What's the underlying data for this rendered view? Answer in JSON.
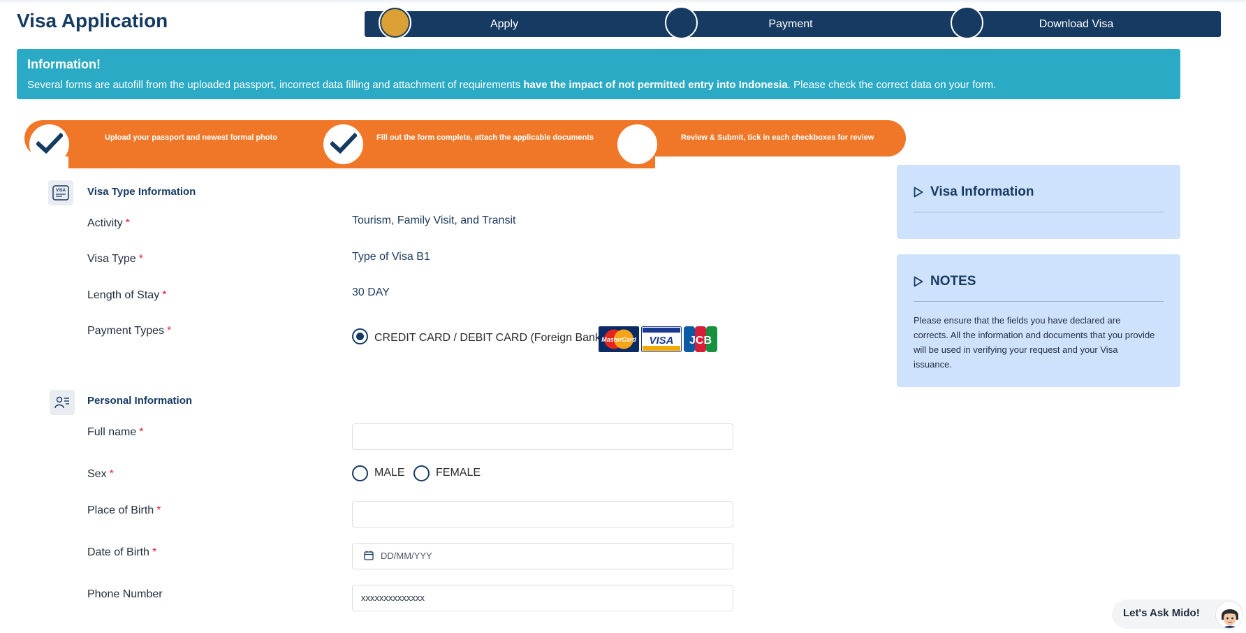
{
  "header": {
    "title": "Visa Application"
  },
  "steps": [
    {
      "label": "Apply",
      "active": true
    },
    {
      "label": "Payment",
      "active": false
    },
    {
      "label": "Download Visa",
      "active": false
    }
  ],
  "info": {
    "title": "Information!",
    "text_before": "Several forms are autofill from the uploaded passport, incorrect data filling and attachment of requirements ",
    "text_bold": "have the impact of not permitted entry into Indonesia",
    "text_after": ". Please check the correct data on your form."
  },
  "progress": [
    {
      "label": "Upload your passport and newest formal photo",
      "done": true
    },
    {
      "label": "Fill out the form complete, attach the applicable documents",
      "done": true
    },
    {
      "label": "Review & Submit, tick in each checkboxes for review",
      "done": false
    }
  ],
  "visa_type": {
    "title": "Visa Type Information",
    "icon": "visa-card-icon",
    "icon_text": "VISA",
    "activity_label": "Activity",
    "activity_value": "Tourism, Family Visit, and Transit",
    "visa_type_label": "Visa Type",
    "visa_type_value": "Type of Visa B1",
    "length_label": "Length of Stay",
    "length_value": "30 DAY",
    "payment_label": "Payment Types",
    "payment_option": "CREDIT CARD / DEBIT CARD (Foreign Bank)",
    "cards": [
      "MasterCard",
      "VISA",
      "JCB"
    ]
  },
  "personal": {
    "title": "Personal Information",
    "icon": "person-list-icon",
    "full_name_label": "Full name",
    "sex_label": "Sex",
    "sex_options": [
      "MALE",
      "FEMALE"
    ],
    "pob_label": "Place of Birth",
    "dob_label": "Date of Birth",
    "dob_placeholder": "DD/MM/YYY",
    "phone_label": "Phone Number",
    "phone_value": "xxxxxxxxxxxxxx",
    "required_mark": "*"
  },
  "sidebar": {
    "visa_info_title": "Visa Information",
    "notes_title": "NOTES",
    "notes_text": "Please ensure that the fields you have declared are corrects. All the information and documents that you provide will be used in verifying your request and your Visa issuance."
  },
  "chat": {
    "label": "Let's Ask Mido!"
  },
  "colors": {
    "navy": "#163a61",
    "orange": "#f07727",
    "teal": "#2aaac4",
    "gold": "#dba036",
    "panel": "#cfe2fd"
  }
}
